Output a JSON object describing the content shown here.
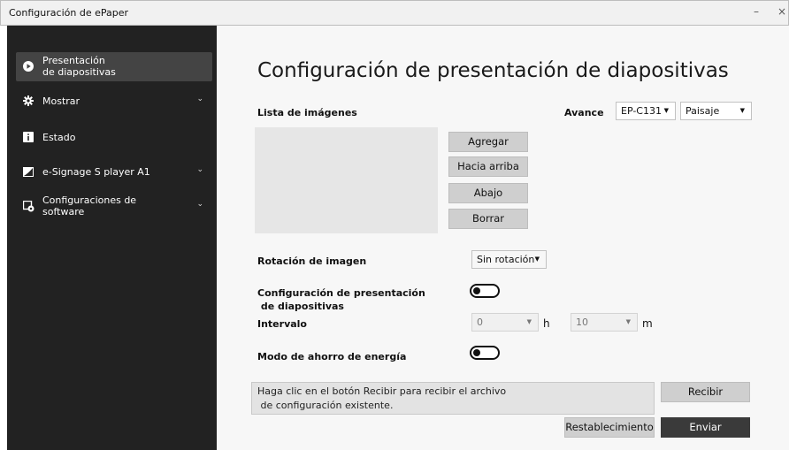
{
  "window": {
    "title": "Configuración de ePaper",
    "minimize_glyph": "–",
    "close_glyph": "×"
  },
  "sidebar": {
    "items": [
      {
        "label": "Presentación\nde diapositivas",
        "icon": "play-circle-icon",
        "active": true,
        "expandable": false
      },
      {
        "label": "Mostrar",
        "icon": "gear-icon",
        "active": false,
        "expandable": true
      },
      {
        "label": "Estado",
        "icon": "info-icon",
        "active": false,
        "expandable": false
      },
      {
        "label": "e-Signage S player A1",
        "icon": "signage-icon",
        "active": false,
        "expandable": true
      },
      {
        "label": "Configuraciones de\nsoftware",
        "icon": "software-settings-icon",
        "active": false,
        "expandable": true
      }
    ],
    "chevron_glyph": "⌄"
  },
  "main": {
    "title": "Configuración de presentación de diapositivas",
    "image_list_label": "Lista de imágenes",
    "advance_label": "Avance",
    "model_select": "EP-C131",
    "orientation_select": "Paisaje",
    "buttons": {
      "add": "Agregar",
      "up": "Hacia arriba",
      "down": "Abajo",
      "delete": "Borrar"
    },
    "rotation_label": "Rotación de imagen",
    "rotation_select": "Sin rotación",
    "slideshow_toggle_label": "Configuración de presentación\n de diapositivas",
    "interval_label": "Intervalo",
    "interval_hours": "0",
    "hours_unit": "h",
    "interval_minutes": "10",
    "minutes_unit": "m",
    "power_save_label": "Modo de ahorro de energía",
    "message": "Haga clic en el botón Recibir para recibir el archivo\n de configuración existente.",
    "receive_button": "Recibir",
    "reset_button": "Restablecimiento",
    "send_button": "Enviar"
  },
  "colors": {
    "sidebar_bg": "#222222",
    "sidebar_active": "#444444",
    "primary_button": "#3a3a3a",
    "secondary_button": "#cfcfcf"
  }
}
